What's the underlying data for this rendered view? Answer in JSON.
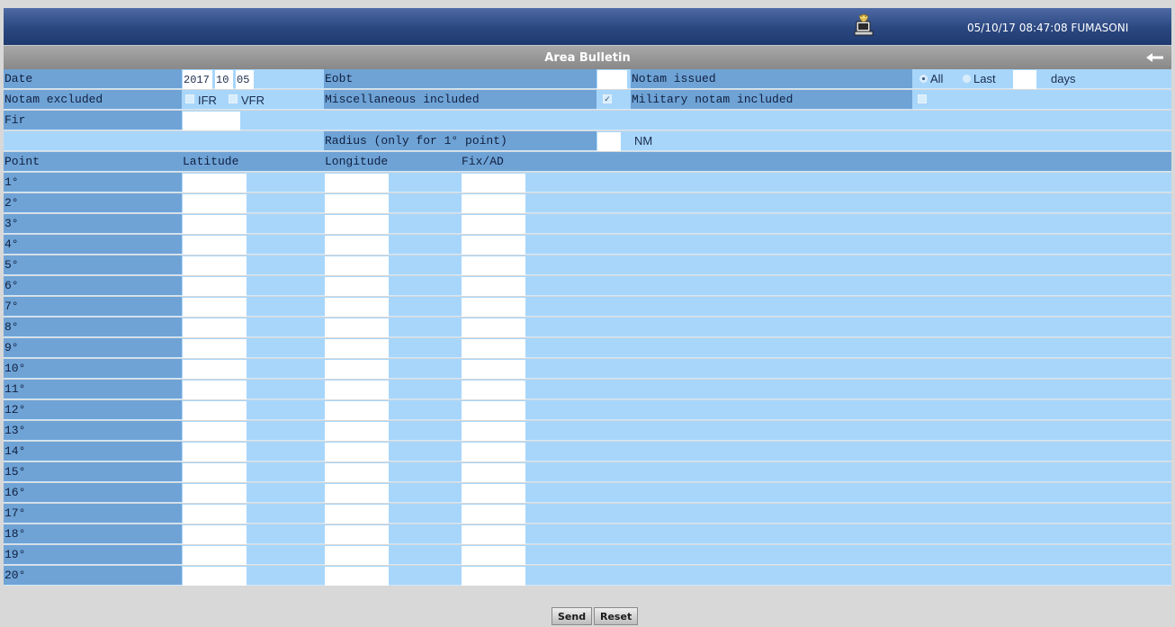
{
  "header": {
    "clock_user": "05/10/17 08:47:08 FUMASONI",
    "user_icon": "user-computer-icon"
  },
  "titlebar": {
    "title": "Area Bulletin",
    "back_icon": "back-arrow-icon"
  },
  "form": {
    "date_label": "Date",
    "date_year": "2017",
    "date_month": "10",
    "date_day": "05",
    "eobt_label": "Eobt",
    "eobt_value": "",
    "notam_issued_label": "Notam issued",
    "notam_issued_all": "All",
    "notam_issued_last": "Last",
    "notam_issued_selected": "All",
    "notam_days_value": "",
    "notam_days_unit": "days",
    "notam_excluded_label": "Notam excluded",
    "ifr_label": "IFR",
    "vfr_label": "VFR",
    "ifr_checked": false,
    "vfr_checked": false,
    "misc_label": "Miscellaneous included",
    "misc_checked": true,
    "military_label": "Military notam included",
    "military_checked": false,
    "fir_label": "Fir",
    "fir_value": "",
    "radius_label": "Radius (only for 1° point)",
    "radius_value": "",
    "radius_unit": "NM"
  },
  "points_table": {
    "headers": {
      "point": "Point",
      "latitude": "Latitude",
      "longitude": "Longitude",
      "fix": "Fix/AD"
    },
    "rows": [
      "1°",
      "2°",
      "3°",
      "4°",
      "5°",
      "6°",
      "7°",
      "8°",
      "9°",
      "10°",
      "11°",
      "12°",
      "13°",
      "14°",
      "15°",
      "16°",
      "17°",
      "18°",
      "19°",
      "20°"
    ]
  },
  "buttons": {
    "send": "Send",
    "reset": "Reset"
  },
  "colors": {
    "header_dark": "#2b4780",
    "label_dark": "#6fa3d6",
    "field_light": "#a8d6fb"
  }
}
